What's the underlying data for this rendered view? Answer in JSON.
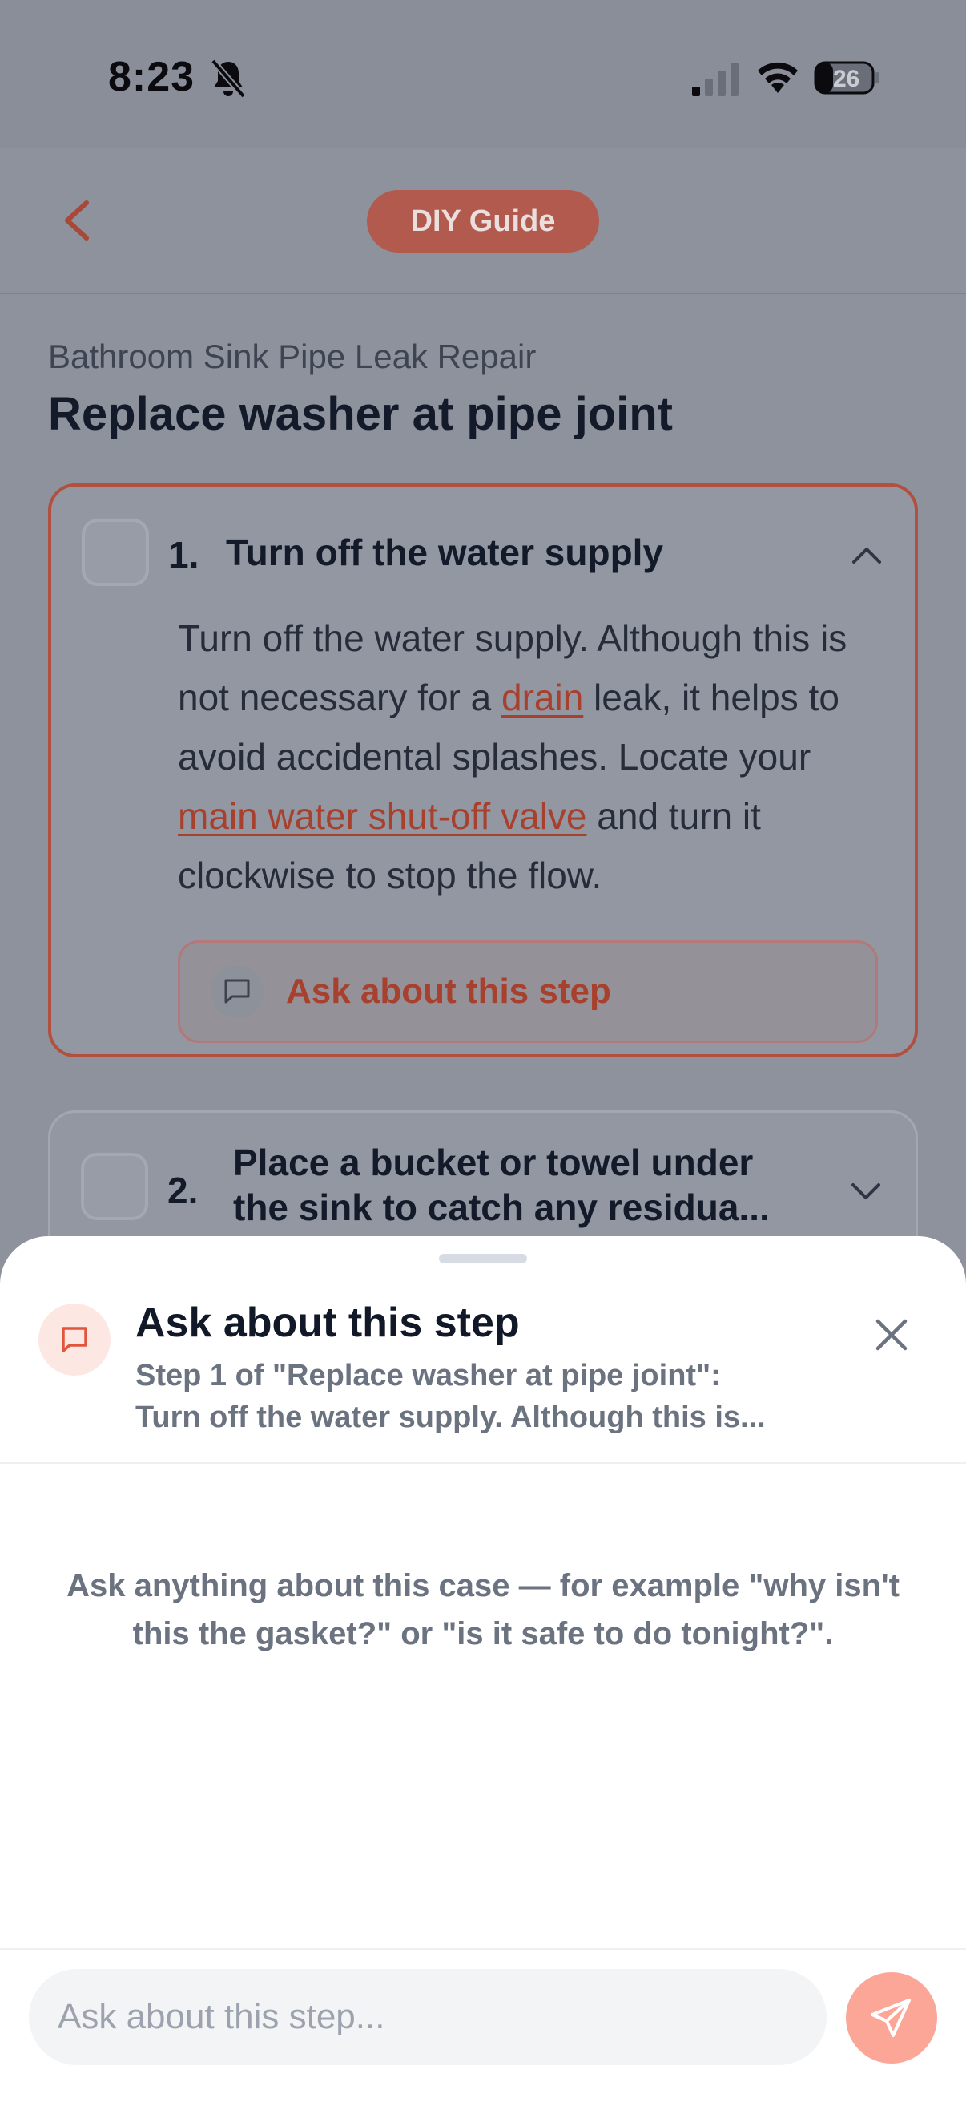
{
  "status_bar": {
    "time": "8:23",
    "battery": "26"
  },
  "header": {
    "badge": "DIY Guide"
  },
  "guide": {
    "name": "Bathroom Sink Pipe Leak Repair",
    "title": "Replace washer at pipe joint"
  },
  "steps": [
    {
      "number": "1.",
      "title": "Turn off the water supply",
      "expanded": true,
      "body": [
        {
          "text": "Turn off the water supply. Although this is not necessary for a "
        },
        {
          "link": "drain"
        },
        {
          "text": " leak, it helps to avoid accidental splashes. Locate your "
        },
        {
          "link": "main water shut-off valve"
        },
        {
          "text": " and turn it clockwise to stop the flow."
        }
      ],
      "ask_label": "Ask about this step"
    },
    {
      "number": "2.",
      "title_line1": "Place a bucket or towel under",
      "title_line2": "the sink to catch any residua...",
      "expanded": false
    }
  ],
  "sheet": {
    "title": "Ask about this step",
    "subtitle_line1": "Step 1 of \"Replace washer at pipe joint\":",
    "subtitle_line2": "Turn off the water supply. Although this is...",
    "hint": "Ask anything about this case — for example \"why isn't this the gasket?\" or \"is it safe to do tonight?\".",
    "input_placeholder": "Ask about this step..."
  },
  "colors": {
    "accent": "#e2553d",
    "accent_soft": "#fca697",
    "overlay_dim": "#8e929c"
  },
  "icons": {
    "back": "chevron-left-icon",
    "bell": "bell-slash-icon",
    "chat": "chat-bubble-icon",
    "close": "close-icon",
    "send": "send-icon",
    "step1_toggle": "chevron-up-icon",
    "step2_toggle": "chevron-down-icon"
  }
}
